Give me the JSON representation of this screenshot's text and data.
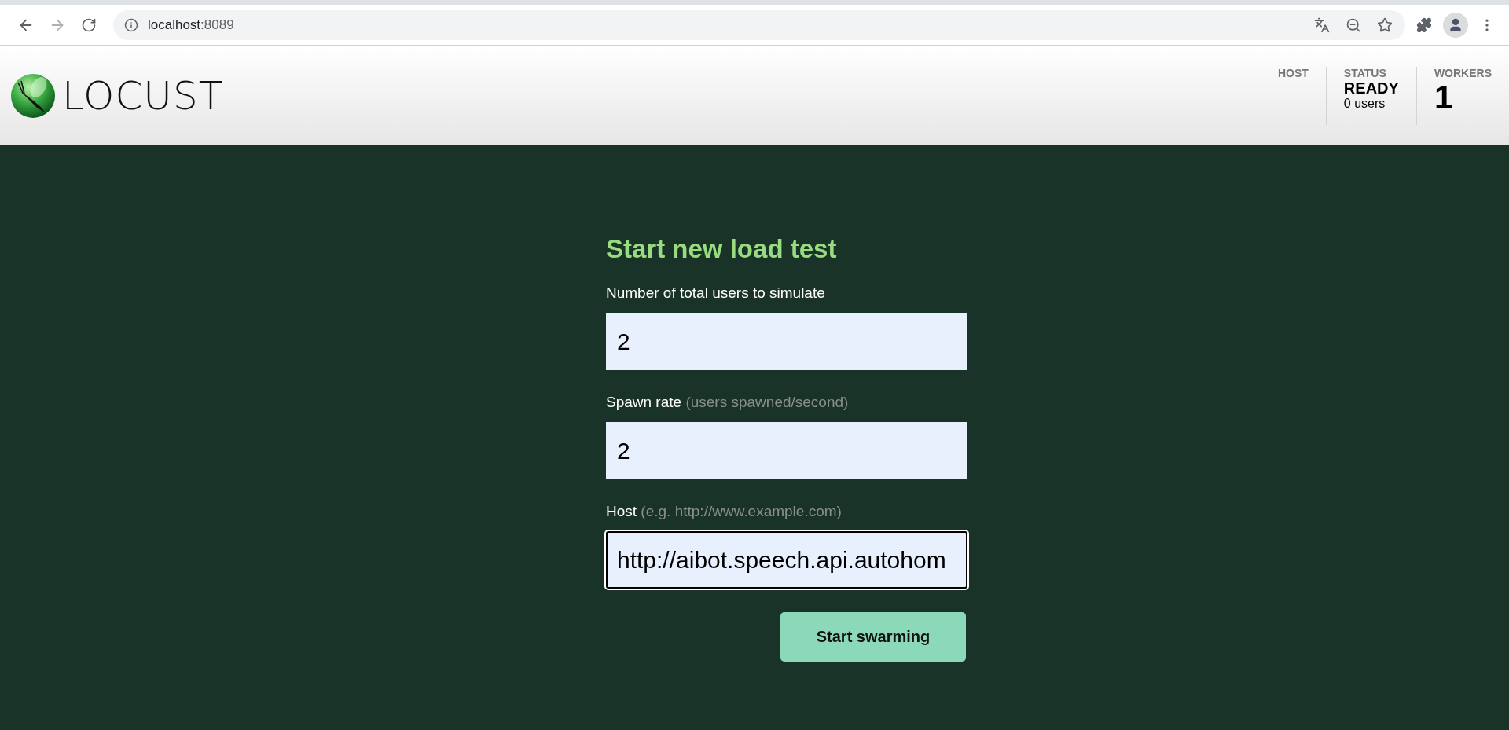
{
  "browser": {
    "url_host": "localhost",
    "url_port": ":8089"
  },
  "header": {
    "logo_text": "LOCUST",
    "stats": [
      {
        "label": "HOST"
      },
      {
        "label": "STATUS",
        "value": "READY",
        "sub": "0 users",
        "big": false
      },
      {
        "label": "WORKERS",
        "value": "1",
        "big": true
      }
    ]
  },
  "form": {
    "title": "Start new load test",
    "fields": [
      {
        "label": "Number of total users to simulate",
        "value": "2",
        "focused": false
      },
      {
        "label": "Spawn rate",
        "hint": "(users spawned/second)",
        "value": "2",
        "focused": false
      },
      {
        "label": "Host",
        "hint": "(e.g. http://www.example.com)",
        "value": "http://aibot.speech.api.autohom",
        "focused": true
      }
    ],
    "submit": "Start swarming"
  }
}
